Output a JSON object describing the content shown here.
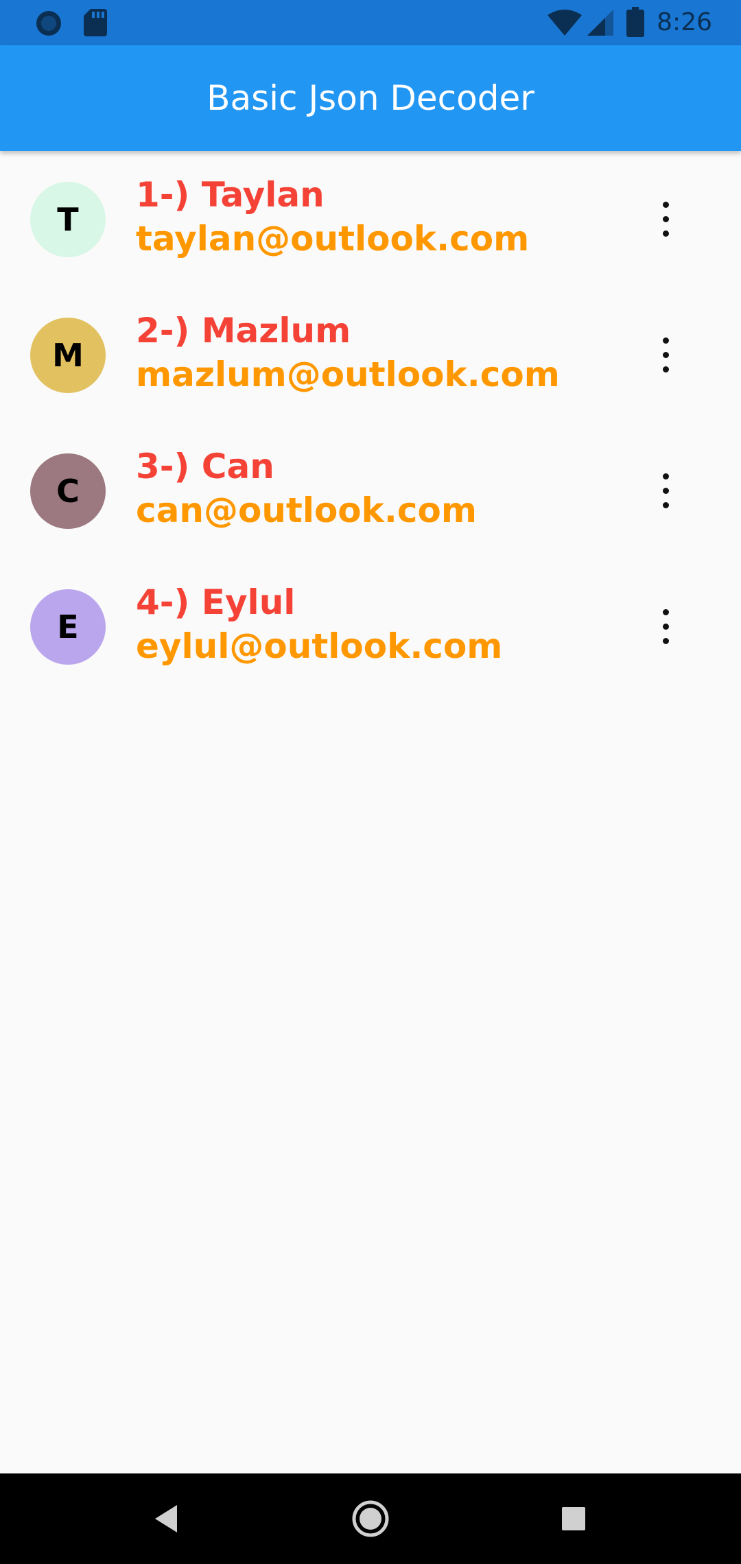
{
  "status_bar": {
    "time": "8:26",
    "icons": [
      "sync-icon",
      "sd-card-icon",
      "wifi-icon",
      "cell-signal-icon",
      "battery-icon"
    ]
  },
  "app_bar": {
    "title": "Basic Json Decoder",
    "color": "#2196f3"
  },
  "colors": {
    "name_text": "#f44336",
    "email_text": "#ff9800"
  },
  "users": [
    {
      "initial": "T",
      "title": "1-) Taylan",
      "email": "taylan@outlook.com",
      "avatar_color": "#d9f7e6",
      "menu_icon": "more-vert-icon"
    },
    {
      "initial": "M",
      "title": "2-) Mazlum",
      "email": "mazlum@outlook.com",
      "avatar_color": "#e2c160",
      "menu_icon": "more-vert-icon"
    },
    {
      "initial": "C",
      "title": "3-) Can",
      "email": "can@outlook.com",
      "avatar_color": "#9c7880",
      "menu_icon": "more-vert-icon"
    },
    {
      "initial": "E",
      "title": "4-) Eylul",
      "email": "eylul@outlook.com",
      "avatar_color": "#baa6ec",
      "menu_icon": "more-vert-icon"
    }
  ],
  "nav_bar": {
    "icons": [
      "back-icon",
      "home-icon",
      "recents-icon"
    ]
  }
}
